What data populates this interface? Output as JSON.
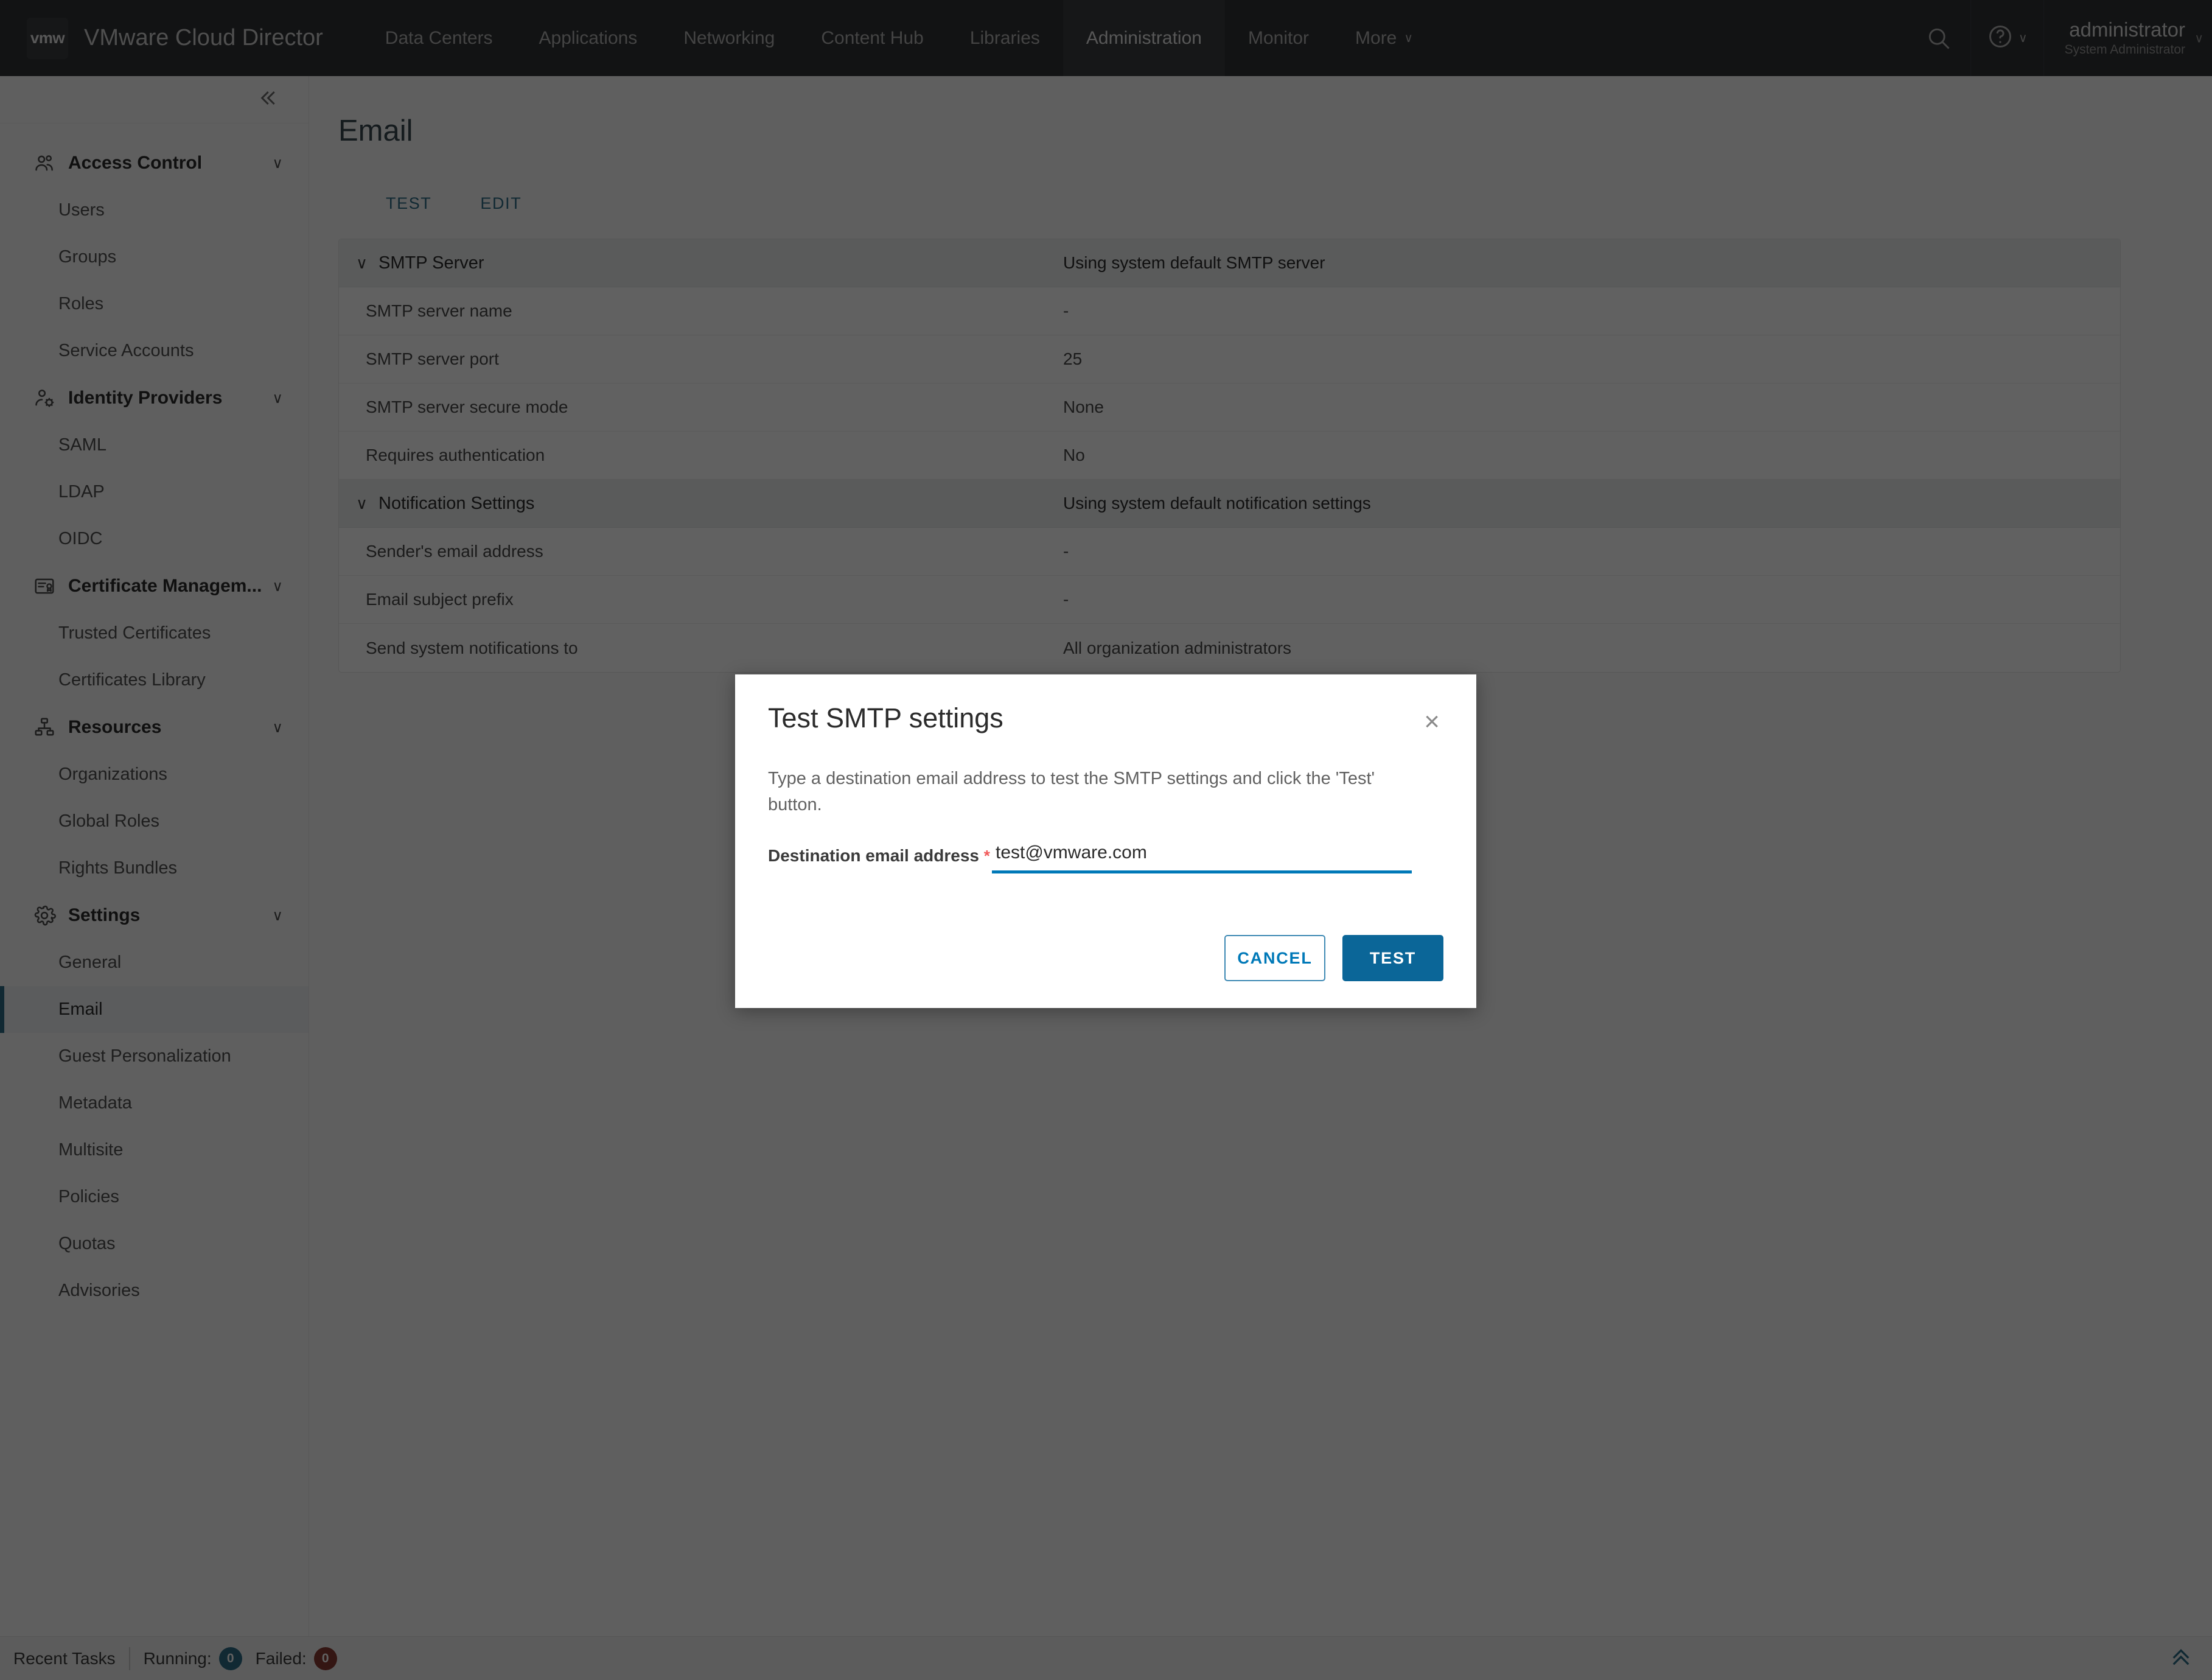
{
  "header": {
    "logo_text": "vmw",
    "product_title": "VMware Cloud Director",
    "nav": [
      {
        "label": "Data Centers",
        "active": false
      },
      {
        "label": "Applications",
        "active": false
      },
      {
        "label": "Networking",
        "active": false
      },
      {
        "label": "Content Hub",
        "active": false
      },
      {
        "label": "Libraries",
        "active": false
      },
      {
        "label": "Administration",
        "active": true
      },
      {
        "label": "Monitor",
        "active": false
      },
      {
        "label": "More",
        "active": false,
        "caret": "∨"
      }
    ],
    "search_icon": "search-icon",
    "help_icon": "help-icon",
    "help_caret": "∨",
    "user": {
      "name": "administrator",
      "role": "System Administrator",
      "caret": "∨"
    }
  },
  "sidebar": {
    "collapse_icon": "double-chevron-left-icon",
    "groups": [
      {
        "label": "Access Control",
        "icon": "users-group-icon",
        "chevron": "∨",
        "children": [
          {
            "label": "Users",
            "selected": false
          },
          {
            "label": "Groups",
            "selected": false
          },
          {
            "label": "Roles",
            "selected": false
          },
          {
            "label": "Service Accounts",
            "selected": false
          }
        ]
      },
      {
        "label": "Identity Providers",
        "icon": "user-gear-icon",
        "chevron": "∨",
        "children": [
          {
            "label": "SAML",
            "selected": false
          },
          {
            "label": "LDAP",
            "selected": false
          },
          {
            "label": "OIDC",
            "selected": false
          }
        ]
      },
      {
        "label": "Certificate Managem...",
        "icon": "certificate-icon",
        "chevron": "∨",
        "children": [
          {
            "label": "Trusted Certificates",
            "selected": false
          },
          {
            "label": "Certificates Library",
            "selected": false
          }
        ]
      },
      {
        "label": "Resources",
        "icon": "sitemap-icon",
        "chevron": "∨",
        "children": [
          {
            "label": "Organizations",
            "selected": false
          },
          {
            "label": "Global Roles",
            "selected": false
          },
          {
            "label": "Rights Bundles",
            "selected": false
          }
        ]
      },
      {
        "label": "Settings",
        "icon": "gear-icon",
        "chevron": "∨",
        "children": [
          {
            "label": "General",
            "selected": false
          },
          {
            "label": "Email",
            "selected": true
          },
          {
            "label": "Guest Personalization",
            "selected": false
          },
          {
            "label": "Metadata",
            "selected": false
          },
          {
            "label": "Multisite",
            "selected": false
          },
          {
            "label": "Policies",
            "selected": false
          },
          {
            "label": "Quotas",
            "selected": false
          },
          {
            "label": "Advisories",
            "selected": false
          }
        ]
      }
    ]
  },
  "main": {
    "page_title": "Email",
    "tabs": [
      {
        "label": "TEST"
      },
      {
        "label": "EDIT"
      }
    ],
    "sections": [
      {
        "type": "section",
        "chevron": "∨",
        "label": "SMTP Server",
        "value": "Using system default SMTP server"
      },
      {
        "type": "row",
        "label": "SMTP server name",
        "value": "-"
      },
      {
        "type": "row",
        "label": "SMTP server port",
        "value": "25"
      },
      {
        "type": "row",
        "label": "SMTP server secure mode",
        "value": "None"
      },
      {
        "type": "row",
        "label": "Requires authentication",
        "value": "No"
      },
      {
        "type": "section",
        "chevron": "∨",
        "label": "Notification Settings",
        "value": "Using system default notification settings"
      },
      {
        "type": "row",
        "label": "Sender's email address",
        "value": "-"
      },
      {
        "type": "row",
        "label": "Email subject prefix",
        "value": "-"
      },
      {
        "type": "row",
        "label": "Send system notifications to",
        "value": "All organization administrators"
      }
    ]
  },
  "modal": {
    "title": "Test SMTP settings",
    "close_icon": "close-icon",
    "close_glyph": "×",
    "description": "Type a destination email address to test the SMTP settings and click the 'Test' button.",
    "field_label": "Destination email address",
    "required_marker": "*",
    "field_value": "test@vmware.com",
    "field_placeholder": "",
    "cancel_label": "CANCEL",
    "test_label": "TEST"
  },
  "footer": {
    "title": "Recent Tasks",
    "running_label": "Running:",
    "running_count": "0",
    "failed_label": "Failed:",
    "failed_count": "0",
    "expand_icon": "double-chevron-up-icon"
  },
  "colors": {
    "header_bg": "#313336",
    "accent": "#0079b8",
    "primary_button": "#0b6698",
    "link": "#2e6d87",
    "required": "#f15a5a",
    "running_badge": "#2e6d87",
    "failed_badge": "#8a3a32"
  }
}
